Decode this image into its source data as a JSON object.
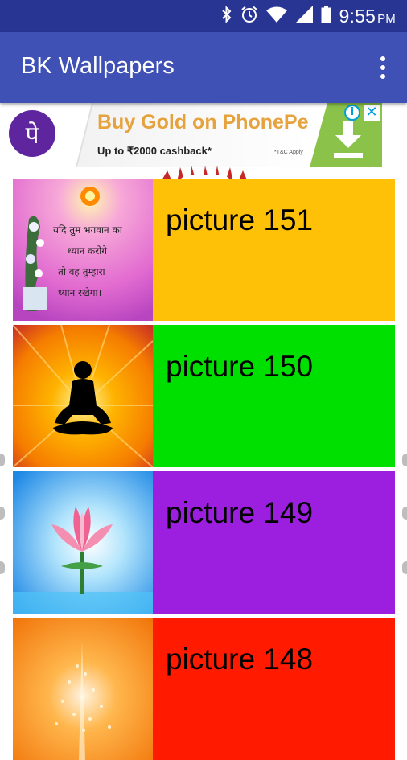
{
  "status_bar": {
    "time": "9:55",
    "ampm": "PM",
    "icons": [
      "bluetooth-icon",
      "alarm-icon",
      "wifi-icon",
      "signal-icon",
      "battery-icon"
    ]
  },
  "app_bar": {
    "title": "BK Wallpapers",
    "menu_icon": "overflow-menu-icon"
  },
  "ad": {
    "logo_glyph": "पे",
    "headline": "Buy Gold on PhonePe",
    "subline": "Up to ₹2000 cashback*",
    "terms": "*T&C Apply",
    "info_glyph": "i",
    "close_glyph": "✕"
  },
  "list": {
    "items": [
      {
        "label": "picture 151",
        "color": "#ffc107",
        "thumb": "krishna-quote",
        "thumb_text": [
          "यदि तुम भगवान का",
          "ध्यान करोगे",
          "तो वह तुम्हारा",
          "ध्यान रखेगा।"
        ]
      },
      {
        "label": "picture 150",
        "color": "#00e000",
        "thumb": "meditation-silhouette"
      },
      {
        "label": "picture 149",
        "color": "#9c1fe0",
        "thumb": "lotus"
      },
      {
        "label": "picture 148",
        "color": "#ff1a00",
        "thumb": "light-burst"
      }
    ]
  },
  "colors": {
    "status_bar": "#283593",
    "app_bar": "#3f51b5",
    "ad_purple": "#5f259f",
    "ad_gold": "#e6a23c",
    "ad_green": "#8bc34a"
  }
}
